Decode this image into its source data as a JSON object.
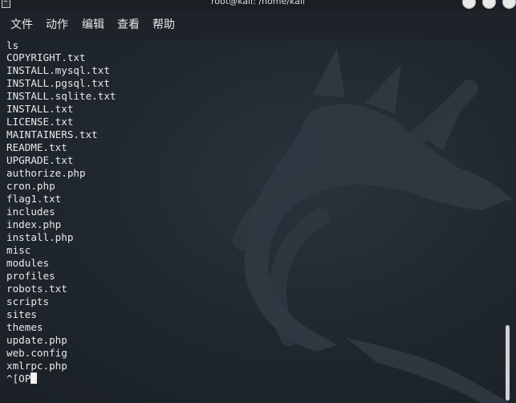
{
  "window": {
    "title": "root@kali: /home/kali"
  },
  "menu": {
    "items": [
      "文件",
      "动作",
      "编辑",
      "查看",
      "帮助"
    ]
  },
  "terminal": {
    "lines": [
      "ls",
      "COPYRIGHT.txt",
      "INSTALL.mysql.txt",
      "INSTALL.pgsql.txt",
      "INSTALL.sqlite.txt",
      "INSTALL.txt",
      "LICENSE.txt",
      "MAINTAINERS.txt",
      "README.txt",
      "UPGRADE.txt",
      "authorize.php",
      "cron.php",
      "flag1.txt",
      "includes",
      "index.php",
      "install.php",
      "misc",
      "modules",
      "profiles",
      "robots.txt",
      "scripts",
      "sites",
      "themes",
      "update.php",
      "web.config",
      "xmlrpc.php"
    ],
    "prompt_input": "^[OP"
  },
  "icons": {
    "app": "terminal-icon",
    "minimize": "minimize-icon",
    "maximize": "maximize-icon",
    "close": "close-icon",
    "background": "kali-dragon-logo"
  },
  "colors": {
    "background": "#1f262d",
    "text": "#e8e8e8",
    "titlebar": "#1a1f24"
  }
}
